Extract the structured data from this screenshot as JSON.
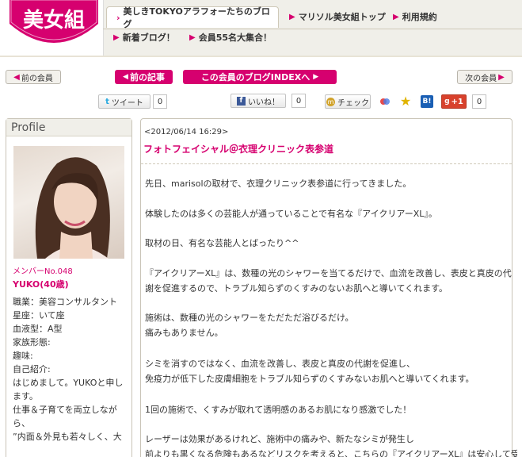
{
  "header": {
    "logo_text": "美女組",
    "tab_blog": "美しきTOKYOアラフォーたちのブログ",
    "nav_top": "マリソル美女組トップ",
    "nav_terms": "利用規約",
    "nav_new": "新着ブログ！",
    "nav_members": "会員55名大集合！"
  },
  "nav_buttons": {
    "prev_member": "前の会員",
    "prev_article": "前の記事",
    "index": "この会員のブログINDEXへ",
    "next_member": "次の会員"
  },
  "social": {
    "tweet": "ツイート",
    "tweet_count": "0",
    "like": "いいね！",
    "like_count": "0",
    "check": "チェック",
    "hatena": "B!",
    "gplus": "+1",
    "gplus_count": "0"
  },
  "profile": {
    "heading": "Profile",
    "member_no": "メンバーNo.048",
    "name": "YUKO(40歳)",
    "lines": [
      "職業：美容コンサルタント",
      "星座：いて座",
      "血液型：A型",
      "家族形態:",
      "趣味:",
      "自己紹介:",
      "はじめまして。YUKOと申し",
      "ます。",
      "仕事＆子育てを両立しなが",
      "ら、",
      "”内面＆外見も若々しく、大"
    ]
  },
  "article": {
    "date": "<2012/06/14 16:29>",
    "title": "フォトフェイシャル＠衣理クリニック表参道",
    "paragraphs": [
      "先日、marisolの取材で、衣理クリニック表参道に行ってきました。",
      "体験したのは多くの芸能人が通っていることで有名な『アイクリアーXL』。",
      "取材の日、有名な芸能人とばったり^^",
      "『アイクリアーXL』は、数種の光のシャワーを当てるだけで、血流を改善し、表皮と真皮の代",
      "謝を促進するので、トラブル知らずのくすみのないお肌へと導いてくれます。",
      "施術は、数種の光のシャワーをただただ浴びるだけ。",
      "痛みもありません。",
      "シミを消すのではなく、血流を改善し、表皮と真皮の代謝を促進し、",
      "免疫力が低下した皮膚細胞をトラブル知らずのくすみないお肌へと導いてくれます。",
      "1回の施術で、くすみが取れて透明感のあるお肌になり感激でした！",
      "レーザーは効果があるけれど、施術中の痛みや、新たなシミが発生し",
      "前よりも黒くなる危険もあるなどリスクを考えると、こちらの『アイクリアーXL』は安心して受け"
    ]
  },
  "colors": {
    "accent": "#d6006f",
    "nav_bg": "#f0efe9"
  }
}
